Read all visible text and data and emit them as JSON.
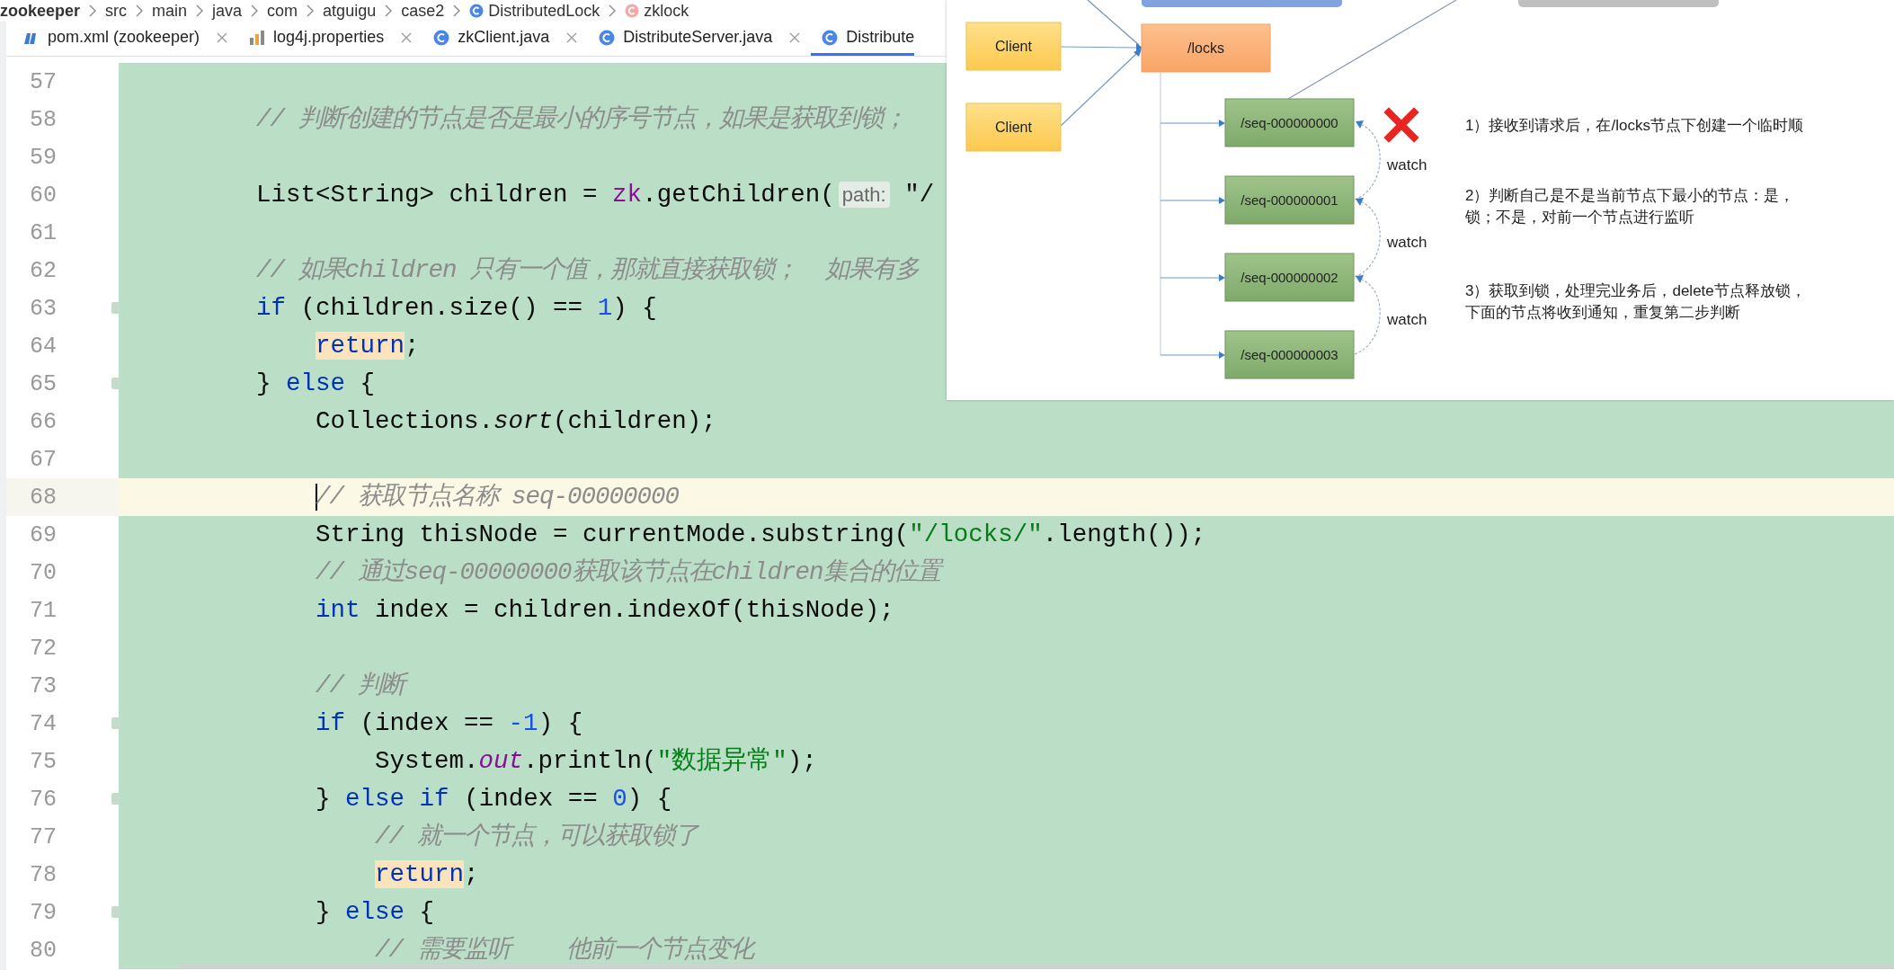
{
  "breadcrumb": [
    {
      "label": "zookeeper",
      "kind": "project"
    },
    {
      "label": "src",
      "kind": "folder"
    },
    {
      "label": "main",
      "kind": "folder"
    },
    {
      "label": "java",
      "kind": "folder"
    },
    {
      "label": "com",
      "kind": "folder"
    },
    {
      "label": "atguigu",
      "kind": "folder"
    },
    {
      "label": "case2",
      "kind": "folder"
    },
    {
      "label": "DistributedLock",
      "kind": "class"
    },
    {
      "label": "zklock",
      "kind": "method"
    }
  ],
  "tabs": [
    {
      "label": "pom.xml (zookeeper)",
      "kind": "maven",
      "selected": false,
      "closable": true
    },
    {
      "label": "log4j.properties",
      "kind": "properties",
      "selected": false,
      "closable": true
    },
    {
      "label": "zkClient.java",
      "kind": "class",
      "selected": false,
      "closable": true
    },
    {
      "label": "DistributeServer.java",
      "kind": "class",
      "selected": false,
      "closable": true
    },
    {
      "label": "Distribute",
      "kind": "class",
      "selected": true,
      "closable": false
    }
  ],
  "editor": {
    "lines": [
      {
        "number": "57",
        "current": false,
        "fold_marker": false
      },
      {
        "number": "58",
        "current": false,
        "fold_marker": false,
        "tokens": [
          {
            "kind": "comment",
            "text": "        // 判断创建的节点是否是最小的序号节点，如果是获取到锁；"
          }
        ]
      },
      {
        "number": "59",
        "current": false,
        "fold_marker": false
      },
      {
        "number": "60",
        "current": false,
        "fold_marker": false,
        "tokens": [
          {
            "kind": "plain",
            "text": "        List<String> children = "
          },
          {
            "kind": "field",
            "text": "zk"
          },
          {
            "kind": "plain",
            "text": ".getChildren("
          },
          {
            "kind": "hint",
            "text": "path:"
          },
          {
            "kind": "plain",
            "text": " \"/"
          }
        ]
      },
      {
        "number": "61",
        "current": false,
        "fold_marker": false
      },
      {
        "number": "62",
        "current": false,
        "fold_marker": false,
        "tokens": [
          {
            "kind": "comment",
            "text": "        // 如果children 只有一个值，那就直接获取锁；  如果有多"
          }
        ]
      },
      {
        "number": "63",
        "current": false,
        "fold_marker": true,
        "tokens": [
          {
            "kind": "keyword",
            "text": "        if"
          },
          {
            "kind": "plain",
            "text": " (children.size() == "
          },
          {
            "kind": "number",
            "text": "1"
          },
          {
            "kind": "plain",
            "text": ") {"
          }
        ]
      },
      {
        "number": "64",
        "current": false,
        "fold_marker": false,
        "tokens": [
          {
            "kind": "keyword-marked",
            "text": "            return"
          },
          {
            "kind": "plain",
            "text": ";"
          }
        ]
      },
      {
        "number": "65",
        "current": false,
        "fold_marker": true,
        "tokens": [
          {
            "kind": "plain",
            "text": "        } "
          },
          {
            "kind": "keyword",
            "text": "else"
          },
          {
            "kind": "plain",
            "text": " {"
          }
        ]
      },
      {
        "number": "66",
        "current": false,
        "fold_marker": false,
        "tokens": [
          {
            "kind": "plain",
            "text": "            Collections."
          },
          {
            "kind": "static",
            "text": "sort"
          },
          {
            "kind": "plain",
            "text": "(children);"
          }
        ]
      },
      {
        "number": "67",
        "current": false,
        "fold_marker": false
      },
      {
        "number": "68",
        "current": true,
        "fold_marker": false,
        "caret": true,
        "tokens": [
          {
            "kind": "comment",
            "text": "            // 获取节点名称 seq-00000000"
          }
        ]
      },
      {
        "number": "69",
        "current": false,
        "fold_marker": false,
        "tokens": [
          {
            "kind": "plain",
            "text": "            String thisNode = currentMode.substring("
          },
          {
            "kind": "string",
            "text": "\"/locks/\""
          },
          {
            "kind": "plain",
            "text": ".length());"
          }
        ]
      },
      {
        "number": "70",
        "current": false,
        "fold_marker": false,
        "tokens": [
          {
            "kind": "comment",
            "text": "            // 通过seq-00000000获取该节点在children集合的位置"
          }
        ]
      },
      {
        "number": "71",
        "current": false,
        "fold_marker": false,
        "tokens": [
          {
            "kind": "keyword",
            "text": "            int"
          },
          {
            "kind": "plain",
            "text": " index = children.indexOf(thisNode);"
          }
        ]
      },
      {
        "number": "72",
        "current": false,
        "fold_marker": false
      },
      {
        "number": "73",
        "current": false,
        "fold_marker": false,
        "tokens": [
          {
            "kind": "comment",
            "text": "            // 判断"
          }
        ]
      },
      {
        "number": "74",
        "current": false,
        "fold_marker": true,
        "tokens": [
          {
            "kind": "keyword",
            "text": "            if"
          },
          {
            "kind": "plain",
            "text": " (index == "
          },
          {
            "kind": "number",
            "text": "-1"
          },
          {
            "kind": "plain",
            "text": ") {"
          }
        ]
      },
      {
        "number": "75",
        "current": false,
        "fold_marker": false,
        "tokens": [
          {
            "kind": "plain",
            "text": "                System."
          },
          {
            "kind": "static-field",
            "text": "out"
          },
          {
            "kind": "plain",
            "text": ".println("
          },
          {
            "kind": "string",
            "text": "\"数据异常\""
          },
          {
            "kind": "plain",
            "text": ");"
          }
        ]
      },
      {
        "number": "76",
        "current": false,
        "fold_marker": true,
        "tokens": [
          {
            "kind": "plain",
            "text": "            } "
          },
          {
            "kind": "keyword",
            "text": "else"
          },
          {
            "kind": "keyword",
            "text": " if"
          },
          {
            "kind": "plain",
            "text": " (index == "
          },
          {
            "kind": "number",
            "text": "0"
          },
          {
            "kind": "plain",
            "text": ") {"
          }
        ]
      },
      {
        "number": "77",
        "current": false,
        "fold_marker": false,
        "tokens": [
          {
            "kind": "comment",
            "text": "                // 就一个节点，可以获取锁了"
          }
        ]
      },
      {
        "number": "78",
        "current": false,
        "fold_marker": false,
        "tokens": [
          {
            "kind": "keyword-marked",
            "text": "                return"
          },
          {
            "kind": "plain",
            "text": ";"
          }
        ]
      },
      {
        "number": "79",
        "current": false,
        "fold_marker": true,
        "tokens": [
          {
            "kind": "plain",
            "text": "            } "
          },
          {
            "kind": "keyword",
            "text": "else"
          },
          {
            "kind": "plain",
            "text": " {"
          }
        ]
      },
      {
        "number": "80",
        "current": false,
        "fold_marker": false,
        "tokens": [
          {
            "kind": "comment",
            "text": "                // 需要监听    他前一个节点变化"
          }
        ]
      }
    ]
  },
  "diagram": {
    "clients": [
      "Client",
      "Client"
    ],
    "root": "/locks",
    "nodes": [
      {
        "label": "/seq-000000000",
        "deleted": true
      },
      {
        "label": "/seq-000000001",
        "deleted": false
      },
      {
        "label": "/seq-000000002",
        "deleted": false
      },
      {
        "label": "/seq-000000003",
        "deleted": false
      }
    ],
    "watch_labels": [
      "watch",
      "watch",
      "watch"
    ],
    "notes": [
      [
        "1）接收到请求后，在/locks节点下创建一个临时顺"
      ],
      [
        "2）判断自己是不是当前节点下最小的节点：是，",
        "锁；不是，对前一个节点进行监听"
      ],
      [
        "3）获取到锁，处理完业务后，delete节点释放锁，",
        "下面的节点将收到通知，重复第二步判断"
      ]
    ]
  }
}
